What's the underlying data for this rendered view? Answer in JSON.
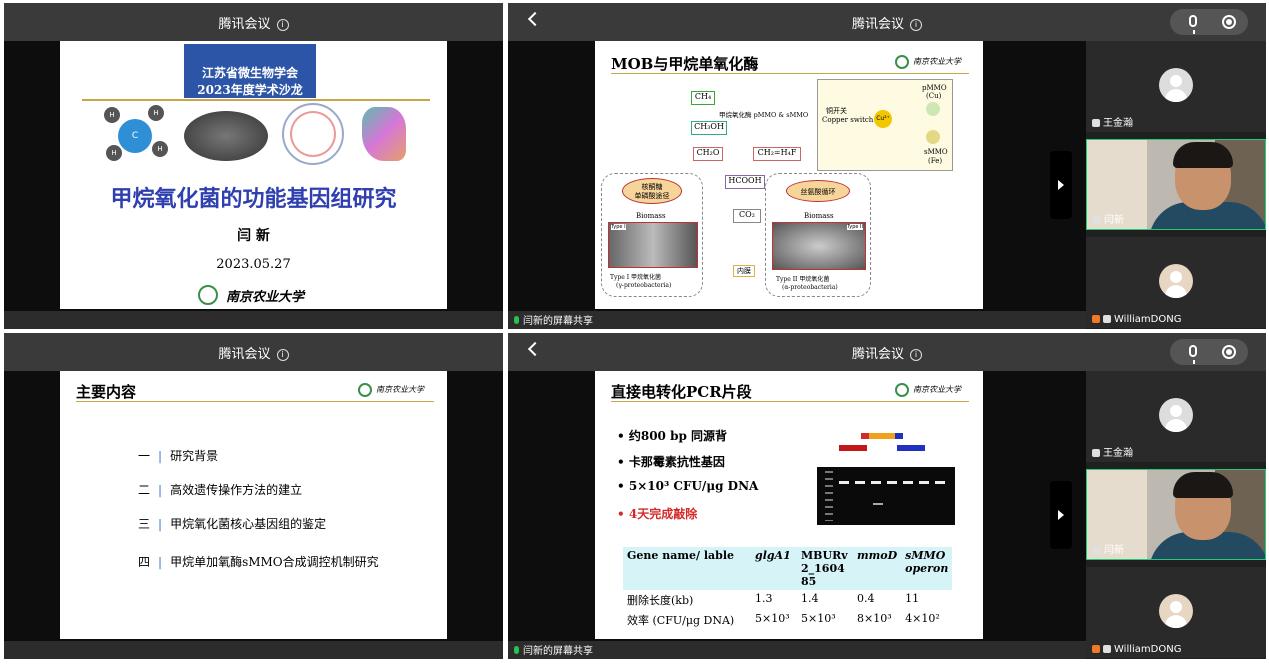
{
  "app_title": "腾讯会议",
  "info_icon": "i",
  "share_label": "闫新的屏幕共享",
  "participants": [
    "王金瀚",
    "闫新",
    "WilliamDONG"
  ],
  "slide1": {
    "banner": [
      "江苏省微生物学会",
      "2023年度学术沙龙"
    ],
    "title": "甲烷氧化菌的功能基因组研究",
    "author": "闫 新",
    "date": "2023.05.27",
    "university": "南京农业大学",
    "methane_h": "H",
    "methane_c": "C"
  },
  "slide2": {
    "title": "MOB与甲烷单氧化酶",
    "ch4": "CH₄",
    "enzyme": "甲烷氧化酶 pMMO & sMMO",
    "ch3oh": "CH₃OH",
    "ch2o": "CH₂O",
    "h4f": "CH₂=H₄F",
    "hcooh": "HCOOH",
    "co2": "CO₂",
    "rump": [
      "核酮糖",
      "单磷酸途径"
    ],
    "serine": "丝氨酸循环",
    "biomass": "Biomass",
    "biomass2": "Biomass",
    "copper": [
      "铜开关",
      "Copper switch"
    ],
    "cu": "Cu²⁺",
    "pmmo": [
      "pMMO",
      "(Cu)"
    ],
    "smmo": [
      "sMMO",
      "(Fe)"
    ],
    "type1": [
      "Type I 甲烷氧化菌",
      "(γ-proteobacteria)"
    ],
    "type2": [
      "Type II 甲烷氧化菌",
      "(α-proteobacteria)"
    ],
    "typeI_tag": "Type I",
    "typeII_tag": "Type II",
    "membrane": "内膜"
  },
  "slide3": {
    "title": "主要内容",
    "items": [
      {
        "num": "一",
        "text": "研究背景"
      },
      {
        "num": "二",
        "text": "高效遗传操作方法的建立"
      },
      {
        "num": "三",
        "text": "甲烷氧化菌核心基因组的鉴定"
      },
      {
        "num": "四",
        "text": "甲烷单加氧酶sMMO合成调控机制研究"
      }
    ]
  },
  "slide4": {
    "title": "直接电转化PCR片段",
    "bullets": [
      {
        "text": "约800 bp 同源背",
        "red": false
      },
      {
        "text": "卡那霉素抗性基因",
        "red": false
      },
      {
        "text": "5×10³ CFU/μg DNA",
        "red": false
      },
      {
        "text": "4天完成敲除",
        "red": true
      }
    ],
    "table": {
      "headers": [
        "Gene name/ lable",
        "glgA1",
        "MBURv2_160485",
        "mmoD",
        "sMMO operon"
      ],
      "rows": [
        [
          "删除长度(kb)",
          "1.3",
          "1.4",
          "0.4",
          "11"
        ],
        [
          "效率 (CFU/μg DNA)",
          "5×10³",
          "5×10³",
          "8×10³",
          "4×10²"
        ]
      ]
    }
  },
  "colors": {
    "title_blue": "#2f3faf",
    "accent_red": "#d62a2a",
    "header_cyan": "#d6f4f8",
    "topbar": "#3a3a3a"
  }
}
